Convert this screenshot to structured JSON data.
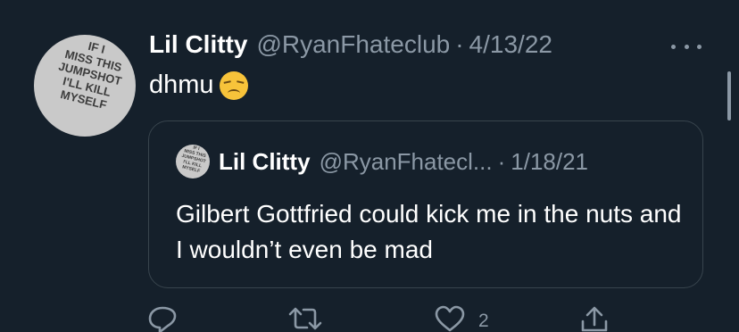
{
  "tweet": {
    "avatar_lines": [
      "IF I",
      "MISS THIS",
      "JUMPSHOT",
      "I'LL KILL",
      "MYSELF"
    ],
    "display_name": "Lil Clitty",
    "handle": "@RyanFhateclub",
    "separator": "·",
    "date": "4/13/22",
    "text": "dhmu",
    "emoji": "disappointed-face-emoji"
  },
  "quote": {
    "avatar_lines": [
      "IF I",
      "MISS THIS",
      "JUMPSHOT",
      "I'LL KILL",
      "MYSELF"
    ],
    "display_name": "Lil Clitty",
    "handle": "@RyanFhatecl...",
    "separator": "·",
    "date": "1/18/21",
    "text": "Gilbert Gottfried could kick me in the nuts and I wouldn’t even be mad"
  },
  "actions": {
    "reply_icon": "reply-icon",
    "retweet_icon": "retweet-icon",
    "like_icon": "heart-icon",
    "like_count": "2",
    "share_icon": "share-icon"
  },
  "colors": {
    "background": "#15202b",
    "secondary_text": "#8b98a5",
    "border": "#38444d"
  }
}
